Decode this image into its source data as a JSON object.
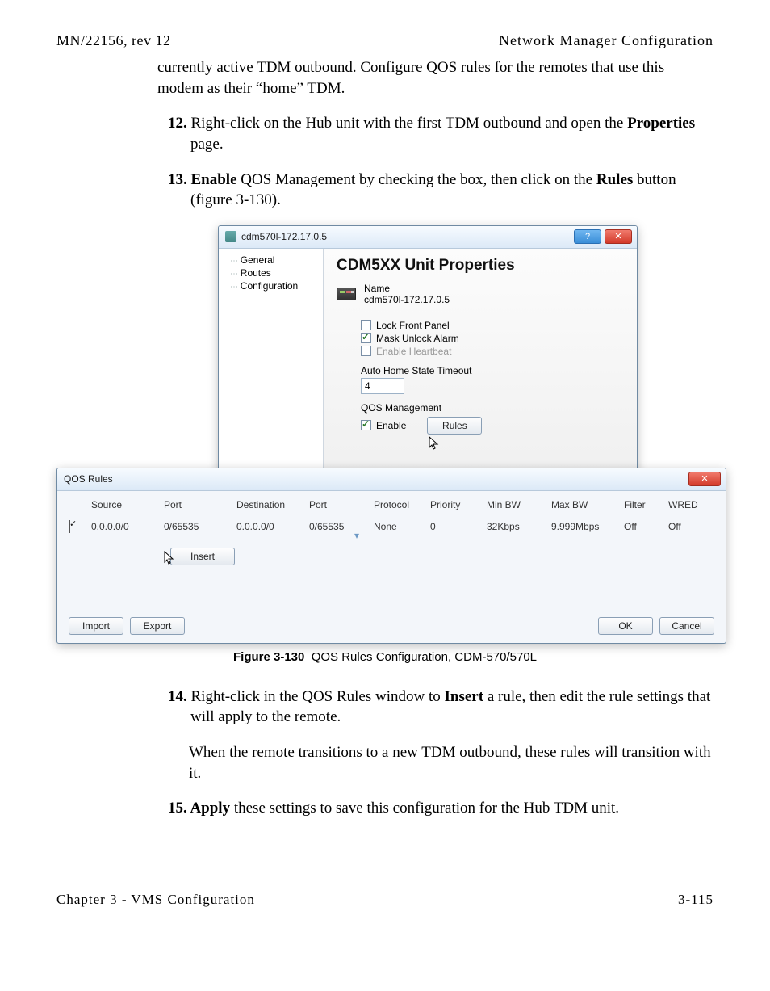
{
  "header": {
    "left": "MN/22156, rev 12",
    "right": "Network Manager Configuration"
  },
  "para_intro": "currently active TDM outbound. Configure QOS rules for the remotes that use this modem as their “home” TDM.",
  "step12_num": "12.",
  "step12_a": " Right-click on the Hub unit with the first TDM outbound and open the ",
  "step12_b": "Properties",
  "step12_c": " page.",
  "step13_num": "13.",
  "step13_a": " Enable",
  "step13_b": " QOS Management by checking the box, then click on the ",
  "step13_c": "Rules",
  "step13_d": " button (figure 3-130).",
  "dialog1": {
    "title": "cdm570l-172.17.0.5",
    "tree": {
      "n1": "General",
      "n2": "Routes",
      "n3": "Configuration"
    },
    "heading": "CDM5XX Unit Properties",
    "name_label": "Name",
    "name_value": "cdm570l-172.17.0.5",
    "opt_lock": "Lock Front Panel",
    "opt_mask": "Mask Unlock Alarm",
    "opt_hb": "Enable Heartbeat",
    "auto_label": "Auto Home State Timeout",
    "auto_value": "4",
    "qos_label": "QOS Management",
    "qos_enable": "Enable",
    "rules_btn": "Rules"
  },
  "dialog2": {
    "title": "QOS Rules",
    "cols": {
      "c1": "",
      "c2": "Source",
      "c3": "Port",
      "c4": "Destination",
      "c5": "Port",
      "c6": "Protocol",
      "c7": "Priority",
      "c8": "Min BW",
      "c9": "Max BW",
      "c10": "Filter",
      "c11": "WRED"
    },
    "row1": {
      "source": "0.0.0.0/0",
      "sport": "0/65535",
      "dest": "0.0.0.0/0",
      "dport": "0/65535",
      "proto": "None",
      "prio": "0",
      "minbw": "32Kbps",
      "maxbw": "9.999Mbps",
      "filter": "Off",
      "wred": "Off"
    },
    "insert_btn": "Insert",
    "import_btn": "Import",
    "export_btn": "Export",
    "ok_btn": "OK",
    "cancel_btn": "Cancel"
  },
  "figure_caption_label": "Figure 3-130",
  "figure_caption_text": "QOS Rules Configuration, CDM-570/570L",
  "step14_num": "14.",
  "step14_a": " Right-click in the QOS Rules window to ",
  "step14_b": "Insert",
  "step14_c": " a rule, then edit the rule settings that will apply to the remote.",
  "step14_note": "When the remote transitions to a new TDM outbound, these rules will transition with it.",
  "step15_num": "15.",
  "step15_a": " Apply",
  "step15_b": " these settings to save this configuration for the Hub TDM unit.",
  "footer": {
    "left": "Chapter 3 - VMS Configuration",
    "right": "3-115"
  }
}
